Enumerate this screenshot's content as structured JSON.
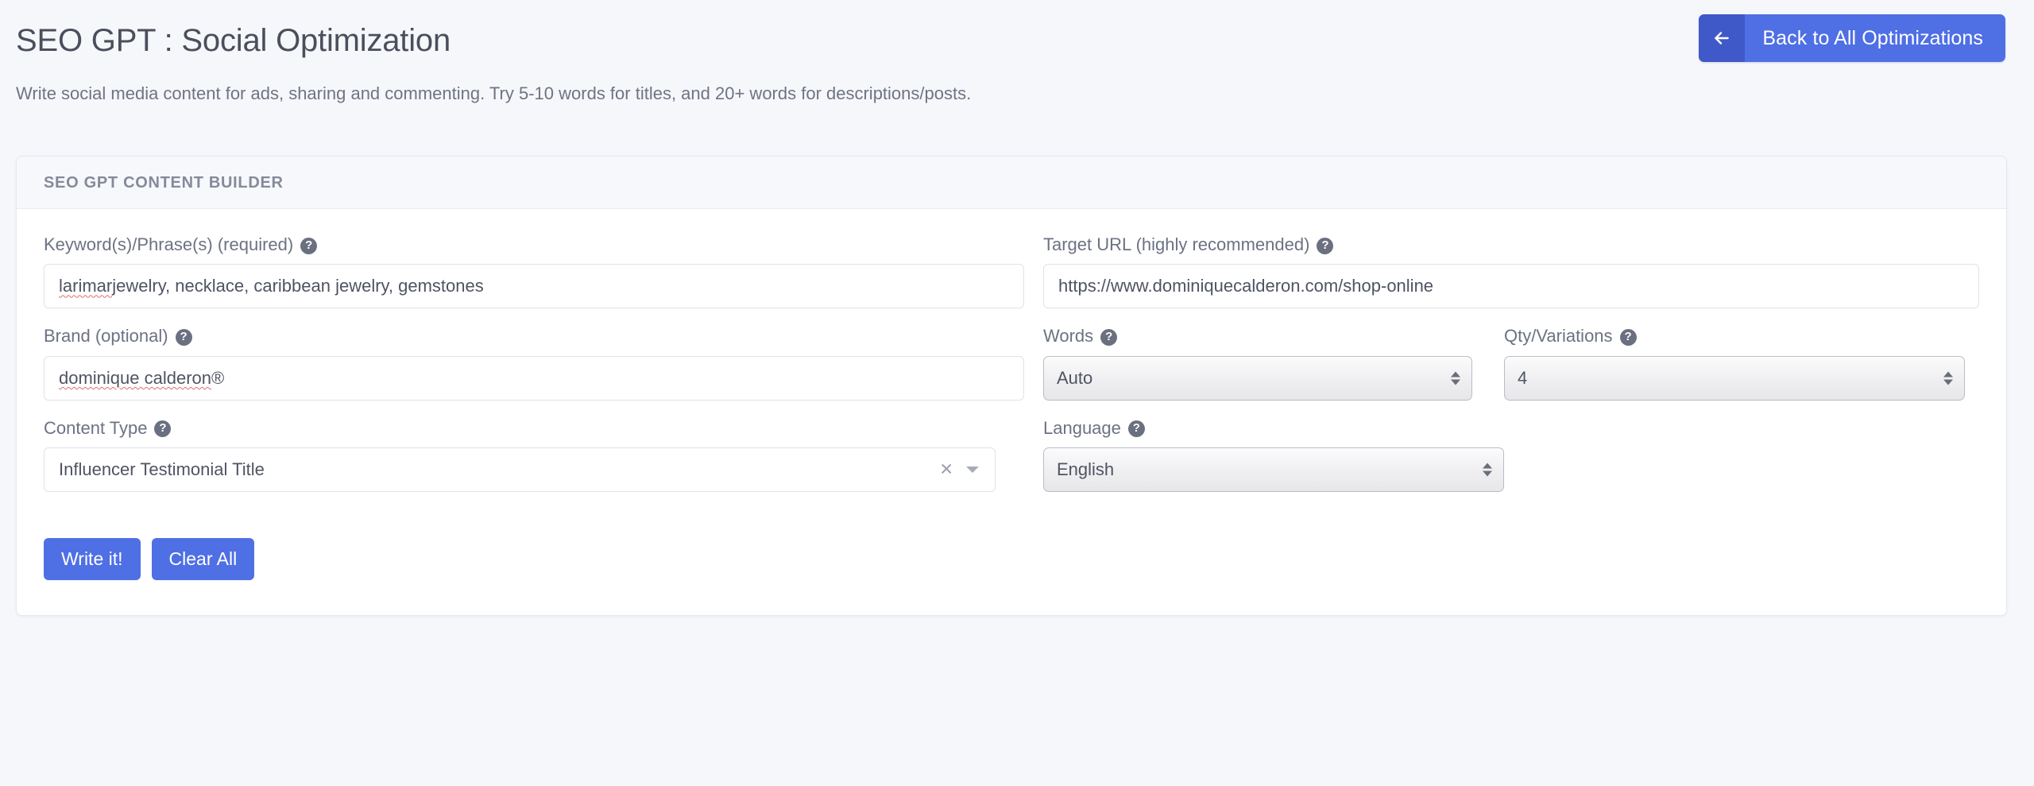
{
  "header": {
    "title": "SEO GPT : Social Optimization",
    "back_button": {
      "label": "Back to All Optimizations",
      "icon": "arrow-left-icon",
      "bg_color": "#4f6fe5",
      "icon_bg_color": "#4059c9"
    }
  },
  "intro": {
    "text": "Write social media content for ads, sharing and commenting. Try 5-10 words for titles, and 20+ words for descriptions/posts."
  },
  "card": {
    "header_title": "SEO GPT CONTENT BUILDER",
    "fields": {
      "keywords": {
        "label": "Keyword(s)/Phrase(s) (required)",
        "help_icon": "question-mark-icon",
        "value_spellchecked": "larimar",
        "value_rest": " jewelry, necklace, caribbean jewelry, gemstones",
        "value": "larimar jewelry, necklace, caribbean jewelry, gemstones"
      },
      "target_url": {
        "label": "Target URL (highly recommended)",
        "help_icon": "question-mark-icon",
        "value": "https://www.dominiquecalderon.com/shop-online"
      },
      "brand": {
        "label": "Brand (optional)",
        "help_icon": "question-mark-icon",
        "value_spellchecked": "dominique calderon",
        "value_rest": " ®",
        "value": "dominique calderon ®"
      },
      "words": {
        "label": "Words",
        "help_icon": "question-mark-icon",
        "value": "Auto"
      },
      "qty_variations": {
        "label": "Qty/Variations",
        "help_icon": "question-mark-icon",
        "value": "4"
      },
      "content_type": {
        "label": "Content Type",
        "help_icon": "question-mark-icon",
        "value": "Influencer Testimonial Title",
        "clear_icon": "close-x-icon",
        "dropdown_icon": "caret-down-icon"
      },
      "language": {
        "label": "Language",
        "help_icon": "question-mark-icon",
        "value": "English"
      }
    },
    "actions": {
      "write": "Write it!",
      "clear": "Clear All"
    }
  },
  "theme": {
    "accent": "#4f6fe5",
    "accent_dark": "#4059c9",
    "page_bg": "#f6f7fb",
    "card_header_bg": "#f7f8fc",
    "text_muted": "#6f7484",
    "spellcheck_underline": "#e06c6c"
  }
}
